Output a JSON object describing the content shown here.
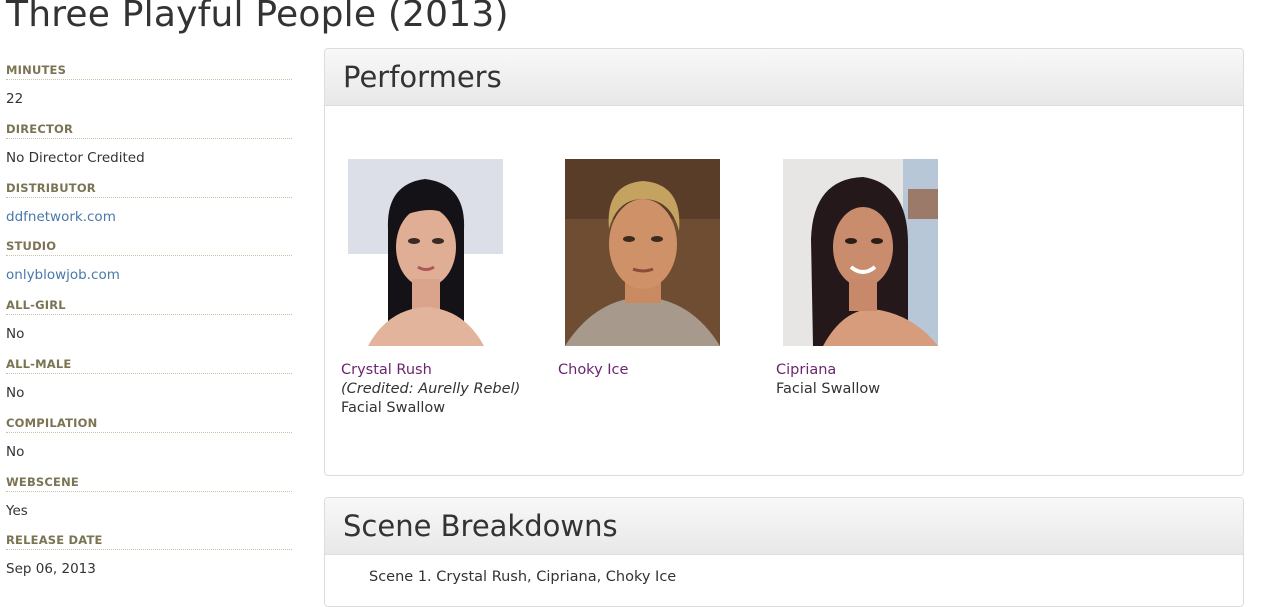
{
  "page": {
    "title": "Three Playful People (2013)"
  },
  "details": [
    {
      "label": "MINUTES",
      "value": "22",
      "is_link": false
    },
    {
      "label": "DIRECTOR",
      "value": "No Director Credited",
      "is_link": false
    },
    {
      "label": "DISTRIBUTOR",
      "value": "ddfnetwork.com",
      "is_link": true
    },
    {
      "label": "STUDIO",
      "value": "onlyblowjob.com",
      "is_link": true
    },
    {
      "label": "ALL-GIRL",
      "value": "No",
      "is_link": false
    },
    {
      "label": "ALL-MALE",
      "value": "No",
      "is_link": false
    },
    {
      "label": "COMPILATION",
      "value": "No",
      "is_link": false
    },
    {
      "label": "WEBSCENE",
      "value": "Yes",
      "is_link": false
    },
    {
      "label": "RELEASE DATE",
      "value": "Sep 06, 2013",
      "is_link": false
    }
  ],
  "performers": {
    "heading": "Performers",
    "items": [
      {
        "name": "Crystal Rush",
        "credit": "(Credited: Aurelly Rebel)",
        "acts": "Facial Swallow"
      },
      {
        "name": "Choky Ice",
        "credit": "",
        "acts": ""
      },
      {
        "name": "Cipriana",
        "credit": "",
        "acts": "Facial Swallow"
      }
    ]
  },
  "scenes": {
    "heading": "Scene Breakdowns",
    "items": [
      "Scene 1. Crystal Rush, Cipriana, Choky Ice"
    ]
  },
  "colors": {
    "link": "#4a78a8",
    "performer_link": "#6b2570",
    "label": "#7a7453"
  }
}
